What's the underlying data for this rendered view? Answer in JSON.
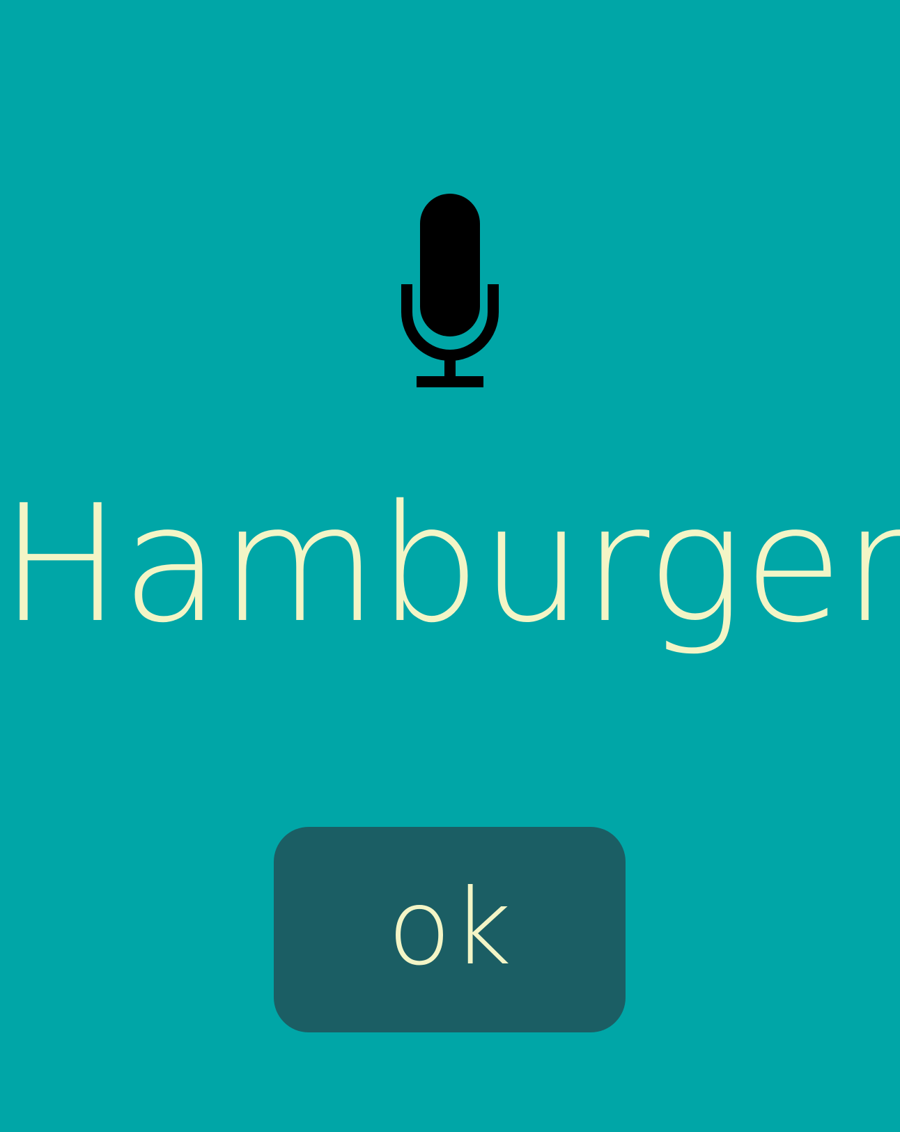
{
  "screen": {
    "background_color": "#00a6a7"
  },
  "mic": {
    "icon": "microphone-icon",
    "color": "#000000"
  },
  "recognized_text": "Hamburger",
  "ok_button": {
    "label": "ok",
    "background_color": "#1b5e64",
    "text_color": "#f3f5c6"
  }
}
